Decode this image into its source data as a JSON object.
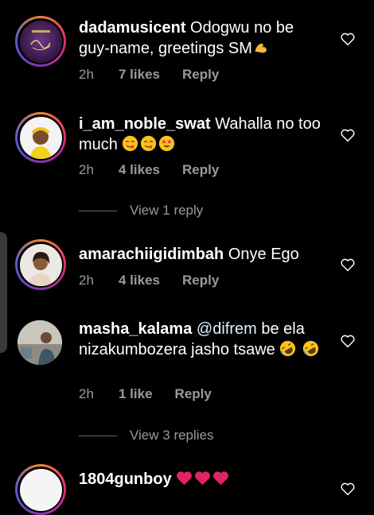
{
  "comments": [
    {
      "username": "dadamusicent",
      "text": "Odogwu no be guy-name, greetings SM",
      "time": "2h",
      "likes": "7 likes",
      "reply_label": "Reply",
      "emojis": [
        "flexed-biceps"
      ]
    },
    {
      "username": "i_am_noble_swat",
      "text": "Wahalla no too much",
      "time": "2h",
      "likes": "4 likes",
      "reply_label": "Reply",
      "emojis": [
        "face-savoring-food",
        "face-savoring-food",
        "star-struck"
      ]
    },
    {
      "username": "amarachiigidimbah",
      "text": "Onye Ego",
      "time": "2h",
      "likes": "4 likes",
      "reply_label": "Reply",
      "emojis": []
    },
    {
      "username": "masha_kalama",
      "mention": "@difrem",
      "text": " be ela nizakumbozera jasho tsawe",
      "time": "2h",
      "likes": "1 like",
      "reply_label": "Reply",
      "emojis": [
        "rolling-on-floor-laughing",
        "rolling-on-floor-laughing"
      ]
    },
    {
      "username": "1804gunboy",
      "text": "",
      "emojis": [
        "red-heart",
        "red-heart",
        "red-heart"
      ]
    }
  ],
  "view_replies": [
    {
      "label": "View 1 reply"
    },
    {
      "label": "View 3 replies"
    }
  ],
  "colors": {
    "background": "#000000",
    "secondary_text": "#9a9a9a",
    "heart_emoji": "#e0245e"
  }
}
